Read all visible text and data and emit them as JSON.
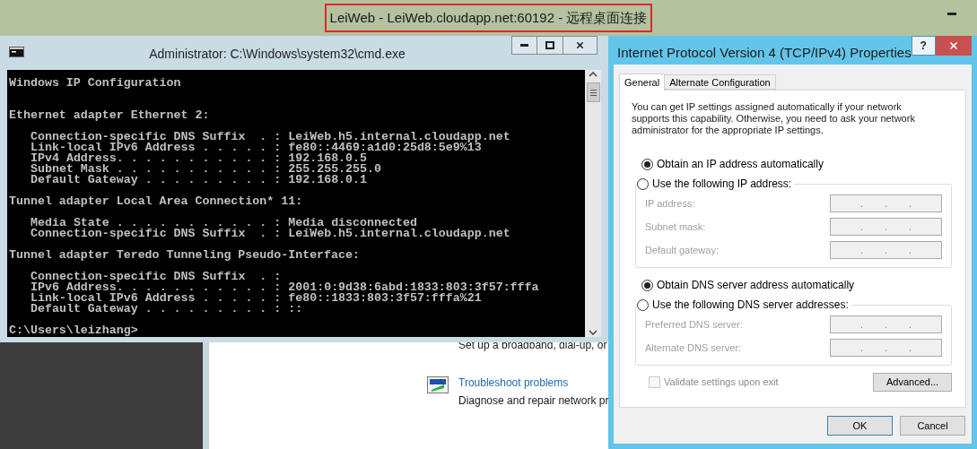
{
  "remote_session": {
    "title": "LeiWeb - LeiWeb.cloudapp.net:60192 - 远程桌面连接"
  },
  "console_window": {
    "title": "Administrator: C:\\Windows\\system32\\cmd.exe",
    "header": "Windows IP Configuration",
    "sections": [
      {
        "heading": "Ethernet adapter Ethernet 2:",
        "lines": [
          "Connection-specific DNS Suffix  . : LeiWeb.h5.internal.cloudapp.net",
          "Link-local IPv6 Address . . . . . : fe80::4469:a1d0:25d8:5e9%13",
          "IPv4 Address. . . . . . . . . . . : 192.168.0.5",
          "Subnet Mask . . . . . . . . . . . : 255.255.255.0",
          "Default Gateway . . . . . . . . . : 192.168.0.1"
        ]
      },
      {
        "heading": "Tunnel adapter Local Area Connection* 11:",
        "lines": [
          "Media State . . . . . . . . . . . : Media disconnected",
          "Connection-specific DNS Suffix  . : LeiWeb.h5.internal.cloudapp.net"
        ]
      },
      {
        "heading": "Tunnel adapter Teredo Tunneling Pseudo-Interface:",
        "lines": [
          "Connection-specific DNS Suffix  . :",
          "IPv6 Address. . . . . . . . . . . : 2001:0:9d38:6abd:1833:803:3f57:fffa",
          "Link-local IPv6 Address . . . . . : fe80::1833:803:3f57:fffa%21",
          "Default Gateway . . . . . . . . . : ::"
        ]
      }
    ],
    "prompt": "C:\\Users\\leizhang>"
  },
  "background_window": {
    "setup_text": "Set up a broadband, dial-up, or",
    "link": "Troubleshoot problems",
    "description": "Diagnose and repair network pr"
  },
  "dialog": {
    "title": "Internet Protocol Version 4 (TCP/IPv4) Properties",
    "help_button": "?",
    "tabs": [
      {
        "label": "General",
        "selected": true
      },
      {
        "label": "Alternate Configuration",
        "selected": false
      }
    ],
    "description": "You can get IP settings assigned automatically if your network supports this capability. Otherwise, you need to ask your network administrator for the appropriate IP settings.",
    "ip_options": [
      {
        "label": "Obtain an IP address automatically",
        "selected": true
      },
      {
        "label": "Use the following IP address:",
        "selected": false
      }
    ],
    "ip_fields_disabled": true,
    "ip_fields": [
      {
        "label": "IP address:",
        "separators": [
          ".",
          ".",
          "."
        ]
      },
      {
        "label": "Subnet mask:",
        "separators": [
          ".",
          ".",
          "."
        ]
      },
      {
        "label": "Default gateway:",
        "separators": [
          ".",
          ".",
          "."
        ]
      }
    ],
    "dns_options": [
      {
        "label": "Obtain DNS server address automatically",
        "selected": true
      },
      {
        "label": "Use the following DNS server addresses:",
        "selected": false
      }
    ],
    "dns_fields_disabled": true,
    "dns_fields": [
      {
        "label": "Preferred DNS server:",
        "separators": [
          ".",
          ".",
          "."
        ]
      },
      {
        "label": "Alternate DNS server:",
        "separators": [
          ".",
          ".",
          "."
        ]
      }
    ],
    "validate": {
      "label": "Validate settings upon exit",
      "checked": false,
      "disabled": true
    },
    "advanced_button": "Advanced...",
    "buttons": [
      {
        "label": "OK",
        "default": true
      },
      {
        "label": "Cancel",
        "default": false
      }
    ]
  }
}
